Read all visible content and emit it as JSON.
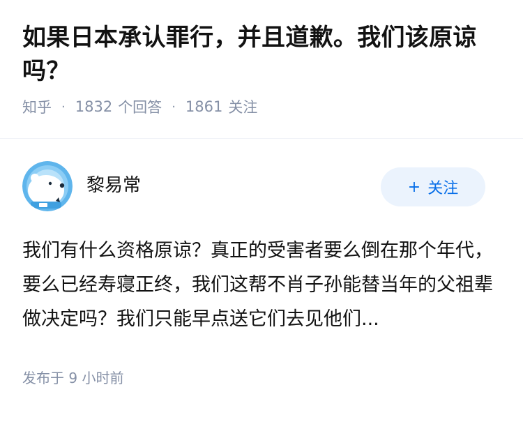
{
  "question": {
    "title": "如果日本承认罪行，并且道歉。我们该原谅吗？",
    "source": "知乎",
    "answer_count": "1832",
    "answer_label": "个回答",
    "follower_count": "1861",
    "follower_label": "关注"
  },
  "answer": {
    "author_name": "黎易常",
    "follow_button": {
      "plus": "+",
      "label": "关注"
    },
    "excerpt": "我们有什么资格原谅？真正的受害者要么倒在那个年代，要么已经寿寝正终，我们这帮不肖子孙能替当年的父祖辈做决定吗？我们只能早点送它们去见他们...",
    "published_time": "发布于 9 小时前"
  },
  "colors": {
    "accent": "#056de8",
    "button_bg": "#ebf3fd",
    "muted_text": "#8590a6",
    "avatar_bg": "#5fb5ec"
  },
  "icons": {
    "avatar": "polar-bear-astronaut-avatar"
  }
}
